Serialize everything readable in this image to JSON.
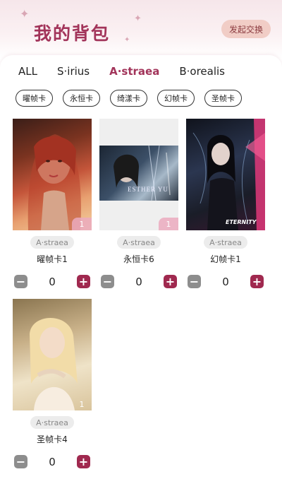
{
  "header": {
    "title": "我的背包",
    "exchange_label": "发起交换"
  },
  "tabs": [
    {
      "label": "ALL",
      "active": false
    },
    {
      "label": "S·irius",
      "active": false
    },
    {
      "label": "A·straea",
      "active": true
    },
    {
      "label": "B·orealis",
      "active": false
    }
  ],
  "filters": [
    "曜帧卡",
    "永恒卡",
    "绮漾卡",
    "幻帧卡",
    "圣帧卡"
  ],
  "cards": [
    {
      "badge": "A·straea",
      "name": "曜帧卡1",
      "count": "1",
      "quantity": "0"
    },
    {
      "badge": "A·straea",
      "name": "永恒卡6",
      "count": "1",
      "quantity": "0",
      "caption": "ESTHER YU"
    },
    {
      "badge": "A·straea",
      "name": "幻帧卡1",
      "count": "",
      "quantity": "0",
      "caption": "ETERNITY"
    },
    {
      "badge": "A·straea",
      "name": "圣帧卡4",
      "count": "1",
      "quantity": "0"
    }
  ],
  "colors": {
    "accent": "#a2345a",
    "plus": "#a0294f",
    "minus": "#8d8d8d"
  }
}
